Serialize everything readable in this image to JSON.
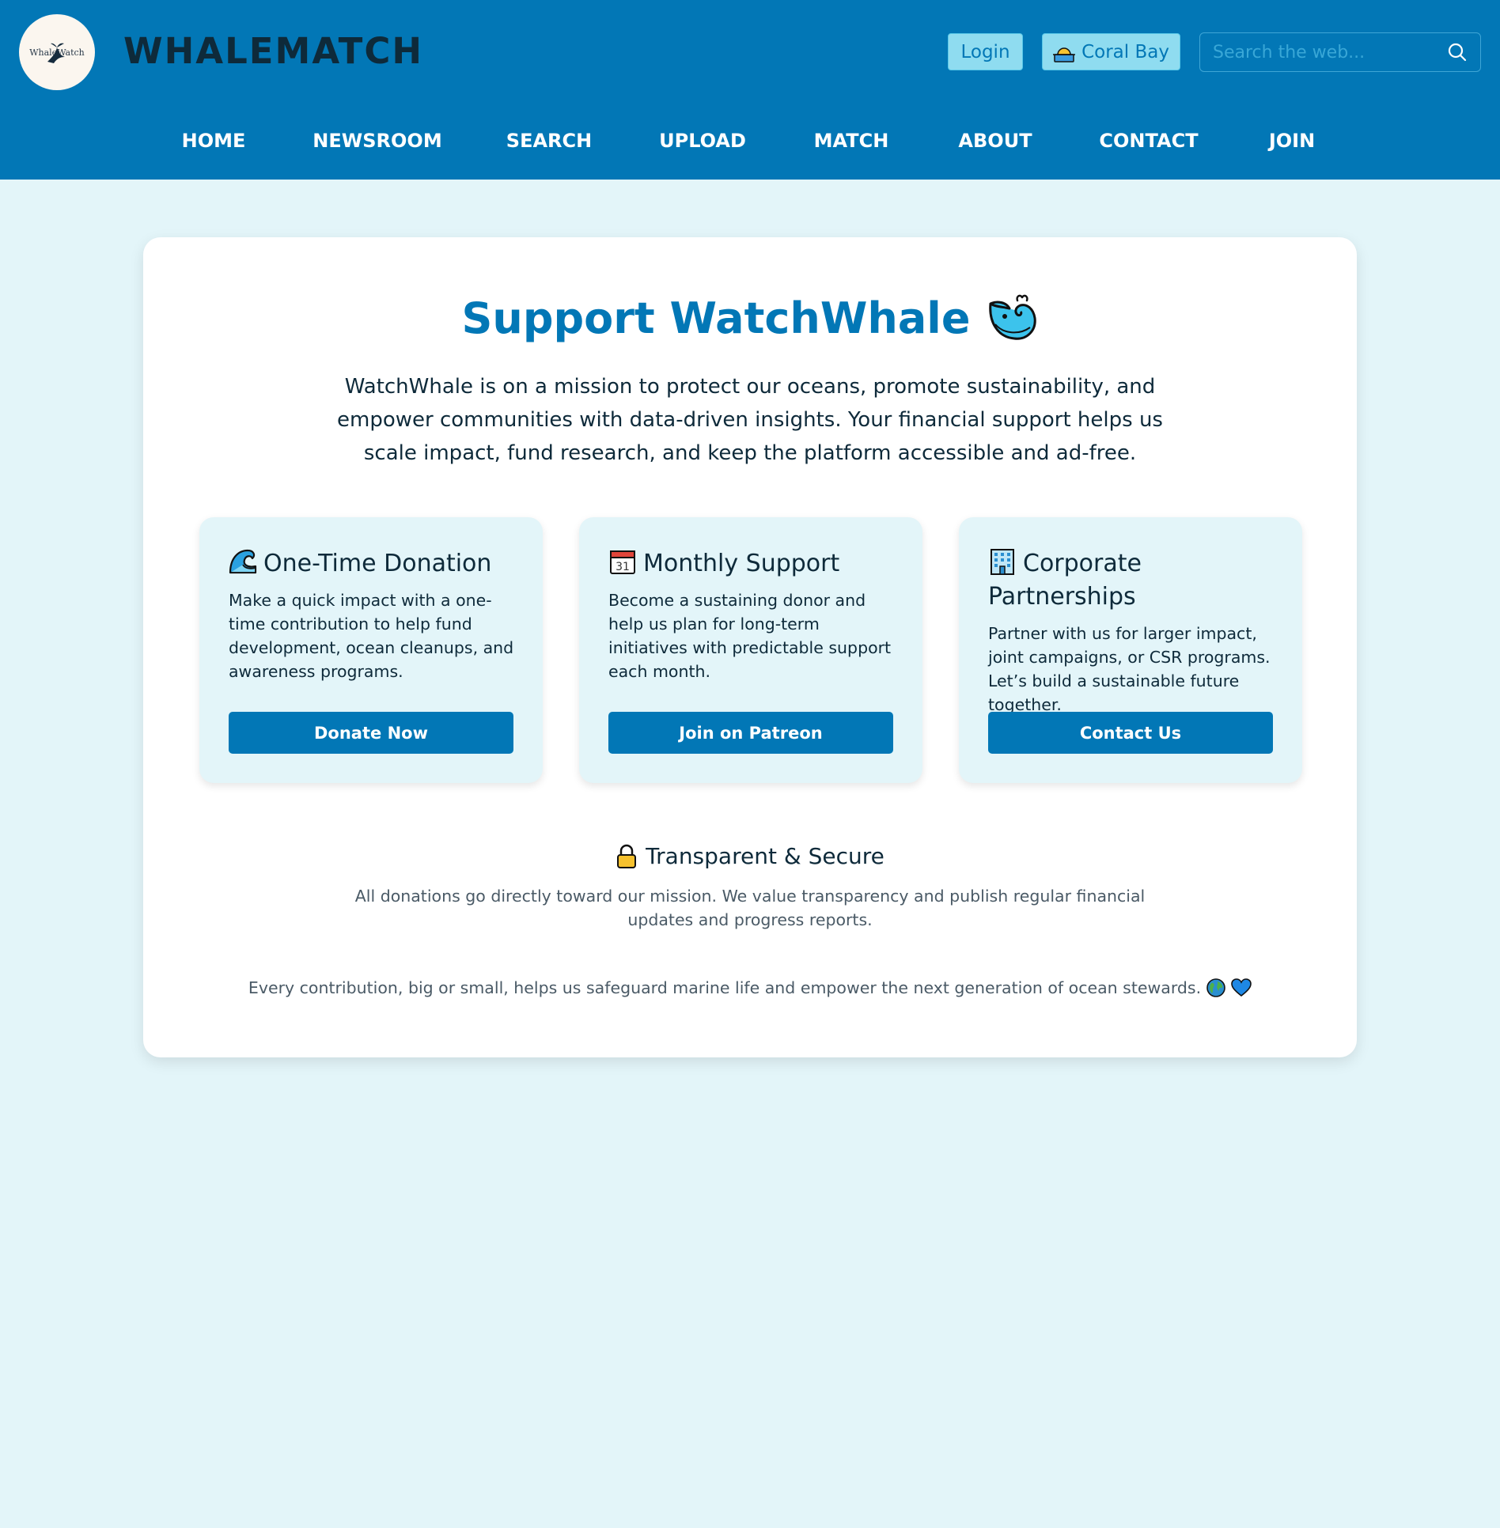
{
  "header": {
    "logo_text": "WhaleWatch",
    "brand": "WHALEMATCH",
    "login_label": "Login",
    "location_label": "Coral Bay",
    "search_placeholder": "Search the web..."
  },
  "nav": {
    "items": [
      {
        "label": "HOME"
      },
      {
        "label": "NEWSROOM"
      },
      {
        "label": "SEARCH"
      },
      {
        "label": "UPLOAD"
      },
      {
        "label": "MATCH"
      },
      {
        "label": "ABOUT"
      },
      {
        "label": "CONTACT"
      },
      {
        "label": "JOIN"
      }
    ]
  },
  "main": {
    "title": "Support WatchWhale",
    "intro": "WatchWhale is on a mission to protect our oceans, promote sustainability, and empower communities with data-driven insights. Your financial support helps us scale impact, fund research, and keep the platform accessible and ad-free.",
    "options": [
      {
        "icon": "wave-icon",
        "title": "One-Time Donation",
        "description": "Make a quick impact with a one-time contribution to help fund development, ocean cleanups, and awareness programs.",
        "button": "Donate Now"
      },
      {
        "icon": "calendar-icon",
        "title": "Monthly Support",
        "description": "Become a sustaining donor and help us plan for long-term initiatives with predictable support each month.",
        "button": "Join on Patreon"
      },
      {
        "icon": "office-building-icon",
        "title": "Corporate Partnerships",
        "description": "Partner with us for larger impact, joint campaigns, or CSR programs. Let’s build a sustainable future together.",
        "button": "Contact Us"
      }
    ],
    "calendar_day": "31",
    "secure": {
      "title": "Transparent & Secure",
      "description": "All donations go directly toward our mission. We value transparency and publish regular financial updates and progress reports."
    },
    "footer_note": "Every contribution, big or small, helps us safeguard marine life and empower the next generation of ocean stewards."
  },
  "colors": {
    "header_bg": "#0277b6",
    "page_bg": "#e3f5f9",
    "accent": "#0277b6",
    "text_dark": "#0e2a3a"
  }
}
